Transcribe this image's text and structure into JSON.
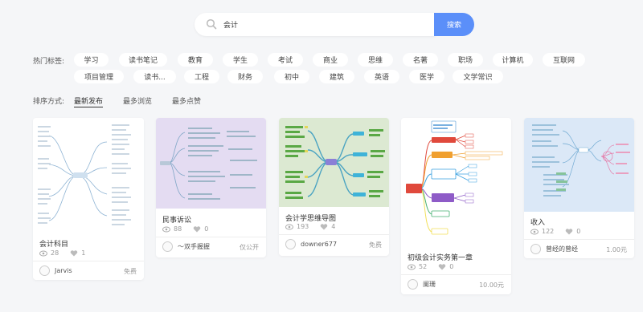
{
  "search": {
    "value": "会计",
    "button_label": "搜索"
  },
  "tags": {
    "label": "热门标签:",
    "items": [
      "学习",
      "读书笔记",
      "教育",
      "学生",
      "考试",
      "商业",
      "思维",
      "名著",
      "职场",
      "计算机",
      "互联网",
      "项目管理",
      "读书...",
      "工程",
      "财务",
      "初中",
      "建筑",
      "英语",
      "医学",
      "文学常识"
    ]
  },
  "sort": {
    "label": "排序方式:",
    "options": [
      "最新发布",
      "最多浏览",
      "最多点赞"
    ],
    "active": "最新发布"
  },
  "cards": [
    {
      "title": "会计科目",
      "views": "28",
      "likes": "1",
      "author": "Jarvis",
      "price": "免费",
      "thumb_bg": "#ffffff"
    },
    {
      "title": "民事诉讼",
      "views": "88",
      "likes": "0",
      "author": "～双手握握",
      "price": "仅公开",
      "thumb_bg": "#e4dcf2"
    },
    {
      "title": "会计学思维导图",
      "views": "193",
      "likes": "4",
      "author": "downer677",
      "price": "免费",
      "thumb_bg": "#dce9d2"
    },
    {
      "title": "初级会计实务第一章",
      "views": "52",
      "likes": "0",
      "author": "阑珊",
      "price": "10.00元",
      "thumb_bg": "#ffffff"
    },
    {
      "title": "收入",
      "views": "122",
      "likes": "0",
      "author": "曾经的曾经",
      "price": "1.00元",
      "thumb_bg": "#dbe8f7"
    }
  ],
  "colors": {
    "accent": "#5b8ff9",
    "page_bg": "#f5f6f8"
  }
}
